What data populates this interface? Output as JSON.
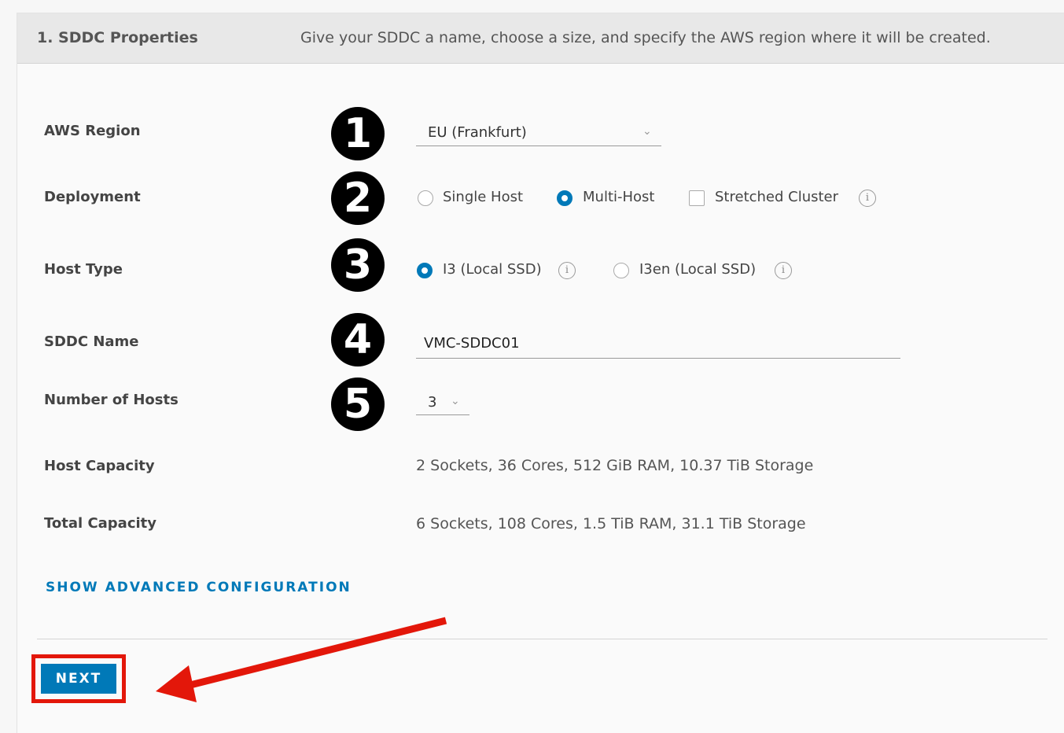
{
  "step": {
    "title": "1. SDDC Properties",
    "description": "Give your SDDC a name, choose a size, and specify the AWS region where it will be created."
  },
  "form": {
    "aws_region": {
      "label": "AWS Region",
      "value": "EU (Frankfurt)",
      "badge": "1"
    },
    "deployment": {
      "label": "Deployment",
      "badge": "2",
      "single_host": "Single Host",
      "multi_host": "Multi-Host",
      "stretched_cluster": "Stretched Cluster",
      "selected": "Multi-Host",
      "stretched_checked": false
    },
    "host_type": {
      "label": "Host Type",
      "badge": "3",
      "i3": "I3 (Local SSD)",
      "i3en": "I3en (Local SSD)",
      "selected": "I3 (Local SSD)"
    },
    "sddc_name": {
      "label": "SDDC Name",
      "value": "VMC-SDDC01",
      "badge": "4"
    },
    "num_hosts": {
      "label": "Number of Hosts",
      "value": "3",
      "badge": "5"
    },
    "host_capacity": {
      "label": "Host Capacity",
      "value": "2 Sockets, 36 Cores, 512 GiB RAM, 10.37 TiB Storage"
    },
    "total_capacity": {
      "label": "Total Capacity",
      "value": "6 Sockets, 108 Cores, 1.5 TiB RAM, 31.1 TiB Storage"
    }
  },
  "advanced_link": "SHOW ADVANCED CONFIGURATION",
  "next_button": "NEXT",
  "icons": {
    "chevron": "chevron-down-icon",
    "info": "info-icon",
    "arrow": "annotation-arrow"
  },
  "colors": {
    "accent": "#0079b8",
    "highlight": "#e3170a"
  }
}
